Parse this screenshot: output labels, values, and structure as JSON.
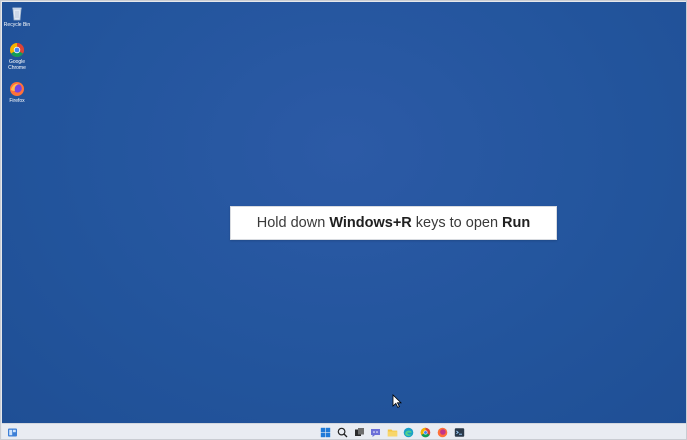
{
  "desktop": {
    "icons": [
      {
        "name": "recycle-bin",
        "label": "Recycle Bin"
      },
      {
        "name": "google-chrome",
        "label": "Google\nChrome"
      },
      {
        "name": "firefox",
        "label": "Firefox"
      }
    ]
  },
  "caption": {
    "part1": "Hold down ",
    "bold1": "Windows+R",
    "part2": " keys to open ",
    "bold2": "Run"
  },
  "taskbar": {
    "icons": [
      "widgets-icon",
      "start-icon",
      "search-icon",
      "task-view-icon",
      "chat-icon",
      "file-explorer-icon",
      "edge-icon",
      "chrome-icon",
      "firefox-icon",
      "terminal-icon"
    ]
  },
  "colors": {
    "desktop_bg": "#23559d",
    "taskbar_bg": "#e9ecf2",
    "caption_bg": "#ffffff"
  }
}
